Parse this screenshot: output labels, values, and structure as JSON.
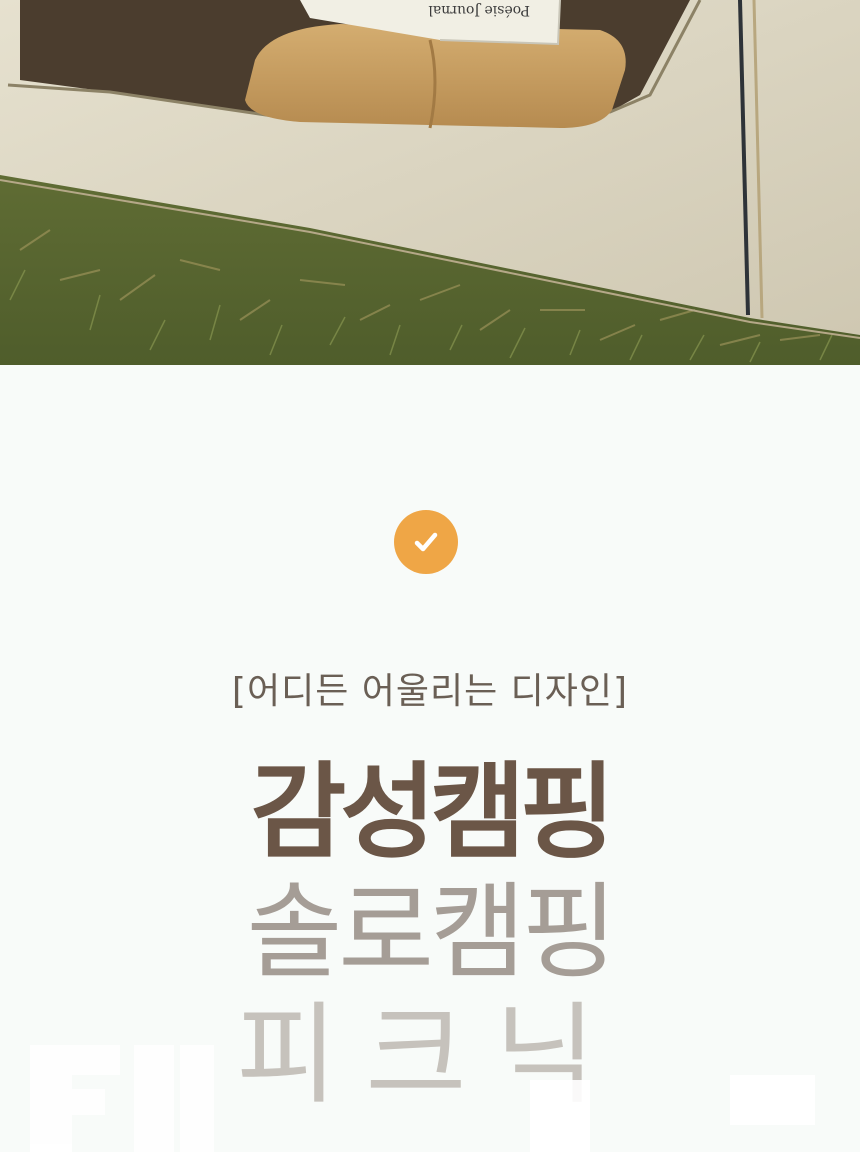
{
  "photo": {
    "book_text": "Poésie Journal",
    "colors": {
      "grass": "#5d6b36",
      "tent": "#dcd7c4",
      "floor": "#4b3d2e",
      "pillow": "#c9a064"
    }
  },
  "badge": {
    "icon": "check-icon",
    "color": "#efa646"
  },
  "subtitle": "[어디든 어울리는 디자인]",
  "headlines": {
    "line1": "감성캠핑",
    "line2": "솔로캠핑",
    "line3": "피크닉"
  },
  "colors": {
    "background": "#f8fbf9",
    "line1": "#6b5647",
    "line2": "#a59d96",
    "line3": "#c6c2bc"
  }
}
